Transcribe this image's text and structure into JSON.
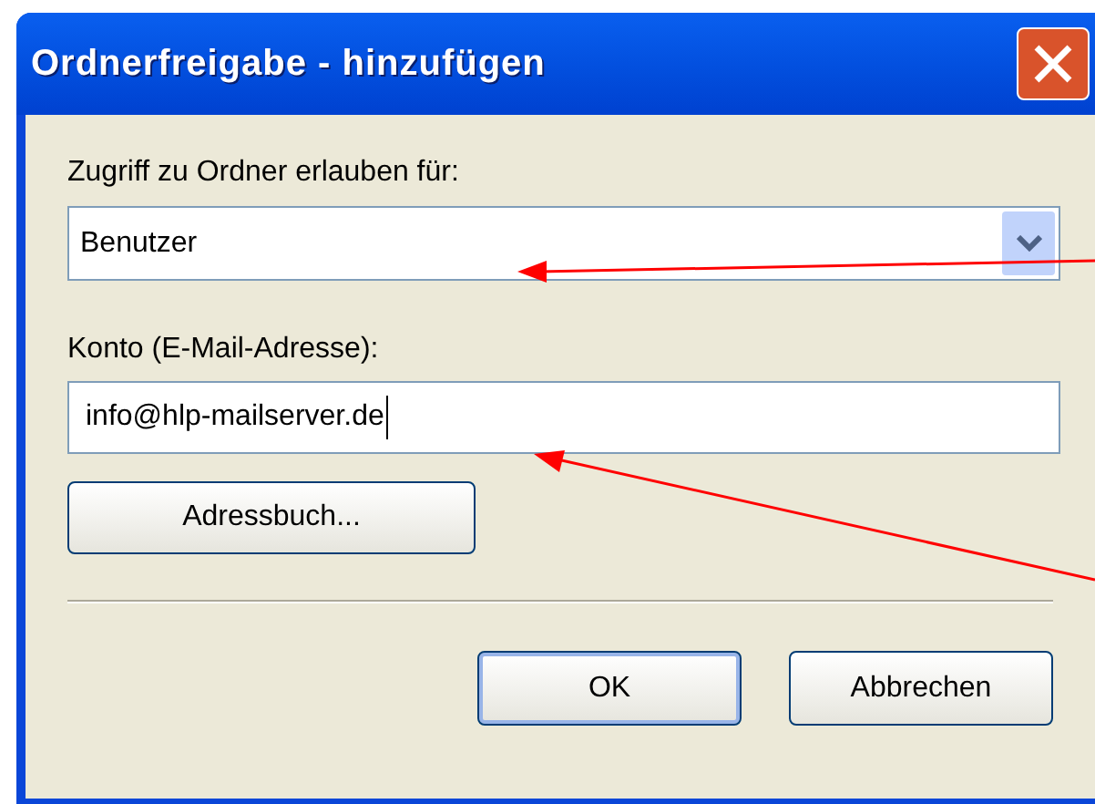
{
  "window": {
    "title": "Ordnerfreigabe - hinzufügen"
  },
  "access": {
    "label": "Zugriff zu Ordner erlauben für:",
    "value": "Benutzer"
  },
  "account": {
    "label": "Konto (E-Mail-Adresse):",
    "value": "info@hlp-mailserver.de"
  },
  "address_book_button": "Adressbuch...",
  "buttons": [
    {
      "label": "OK",
      "default": true
    },
    {
      "label": "Abbrechen",
      "default": false
    }
  ]
}
